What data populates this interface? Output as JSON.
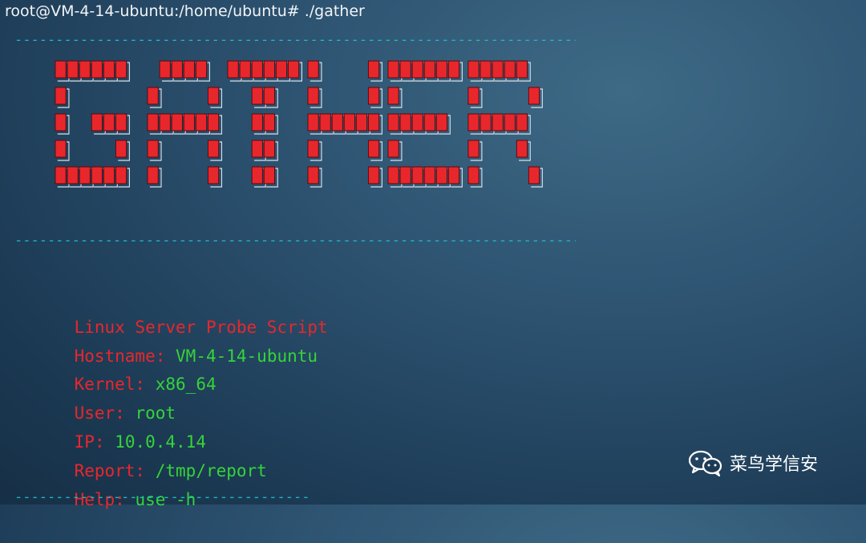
{
  "terminal": {
    "prompt": "root@VM-4-14-ubuntu:/home/ubuntu# ./gather",
    "rule_long": "----------------------------------------------------------------------------------",
    "rule_short": "------------------------------------",
    "banner_text": "GATHER"
  },
  "info": {
    "title": "Linux Server Probe Script",
    "hostname_key": "Hostname:",
    "hostname_val": "VM-4-14-ubuntu",
    "kernel_key": "Kernel:",
    "kernel_val": "x86_64",
    "user_key": "User:",
    "user_val": "root",
    "ip_key": "IP:",
    "ip_val": "10.0.4.14",
    "report_key": "Report:",
    "report_val": "/tmp/report",
    "help_key": "Help:",
    "help_val": "use -h"
  },
  "watermark": {
    "text": "菜鸟学信安",
    "icon": "wechat-icon"
  },
  "colors": {
    "accent_red": "#e8272c",
    "value_green": "#35d43a",
    "rule_cyan": "#1fb7c4"
  }
}
